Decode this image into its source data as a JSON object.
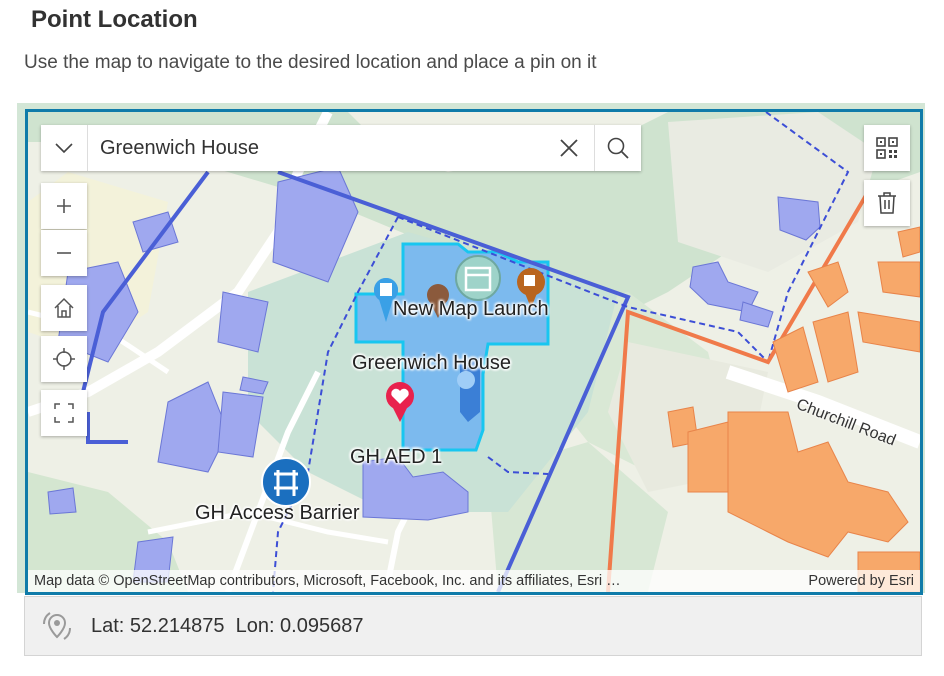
{
  "header": {
    "title": "Point Location",
    "instructions": "Use the map to navigate to the desired location and place a pin on it"
  },
  "search": {
    "value": "Greenwich House"
  },
  "map": {
    "labels": {
      "new_map_launch": "New Map Launch",
      "greenwich_house": "Greenwich House",
      "gh_aed": "GH AED 1",
      "gh_access_barrier": "GH Access Barrier",
      "churchill_road": "Churchill Road"
    },
    "attribution": "Map data © OpenStreetMap contributors, Microsoft, Facebook, Inc. and its affiliates, Esri …",
    "powered_by": "Powered by Esri",
    "colors": {
      "building_blue": "#9fa8ef",
      "highlight": "#6fb3f2",
      "boundary": "#4a5fd6",
      "orange_building": "#f7a86a",
      "orange_line": "#f07a4a"
    }
  },
  "coordinates": {
    "display": "Lat: 52.214875  Lon: 0.095687",
    "lat": 52.214875,
    "lon": 0.095687
  }
}
